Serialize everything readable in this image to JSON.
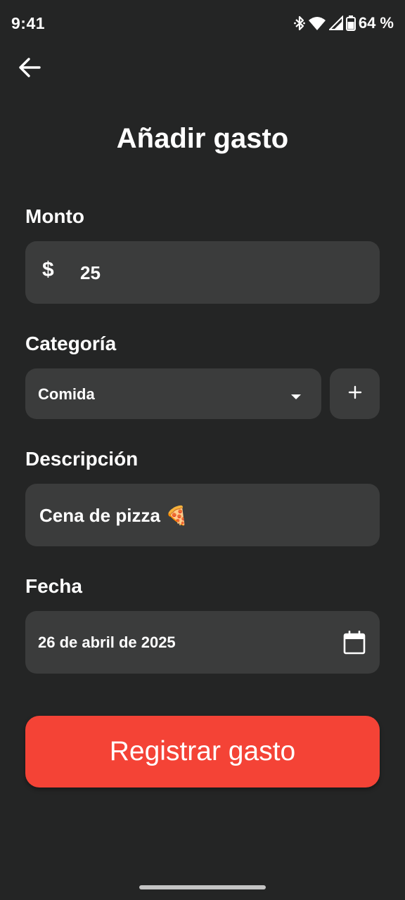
{
  "status_bar": {
    "time": "9:41",
    "battery_percent": "64 %",
    "icons": [
      "bluetooth-icon",
      "wifi-icon",
      "cell-signal-icon",
      "battery-icon"
    ]
  },
  "header": {
    "back_icon": "arrow-left-icon",
    "title": "Añadir gasto"
  },
  "form": {
    "amount": {
      "label": "Monto",
      "currency_symbol": "$",
      "value": "25"
    },
    "category": {
      "label": "Categoría",
      "selected": "Comida",
      "dropdown_icon": "caret-down-icon",
      "add_icon": "plus-icon"
    },
    "description": {
      "label": "Descripción",
      "value": "Cena de pizza 🍕"
    },
    "date": {
      "label": "Fecha",
      "value": "26 de abril de 2025",
      "icon": "calendar-icon"
    }
  },
  "submit": {
    "label": "Registrar gasto"
  },
  "colors": {
    "background": "#242525",
    "field": "#3b3c3c",
    "accent": "#f44336",
    "text": "#ffffff"
  }
}
